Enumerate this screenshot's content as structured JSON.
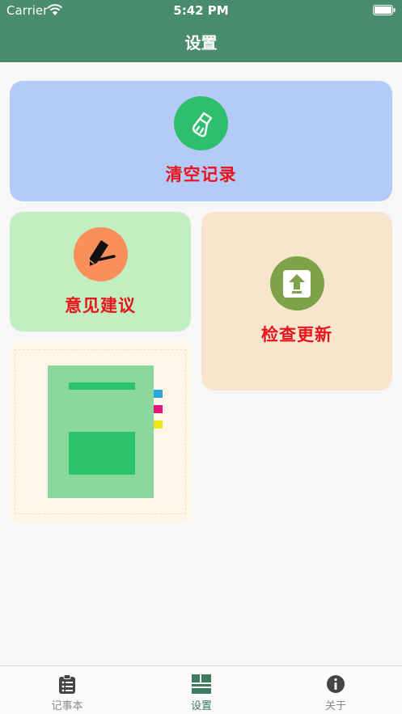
{
  "status_bar": {
    "carrier": "Carrier",
    "time": "5:42 PM"
  },
  "nav": {
    "title": "设置"
  },
  "cards": {
    "clear": {
      "label": "清空记录",
      "icon": "broom-icon",
      "color": "#b3cbf6"
    },
    "feedback": {
      "label": "意见建议",
      "icon": "pen-icon",
      "color": "#c2efc2"
    },
    "update": {
      "label": "检查更新",
      "icon": "upload-icon",
      "color": "#f8e5cd"
    }
  },
  "tabbar": {
    "items": [
      {
        "label": "记事本",
        "icon": "clipboard-list-icon",
        "active": false
      },
      {
        "label": "设置",
        "icon": "grid-icon",
        "active": true
      },
      {
        "label": "关于",
        "icon": "info-icon",
        "active": false
      }
    ]
  },
  "colors": {
    "header": "#488b6e",
    "accent_text": "#e8141c",
    "active_tab": "#3f7a61"
  }
}
